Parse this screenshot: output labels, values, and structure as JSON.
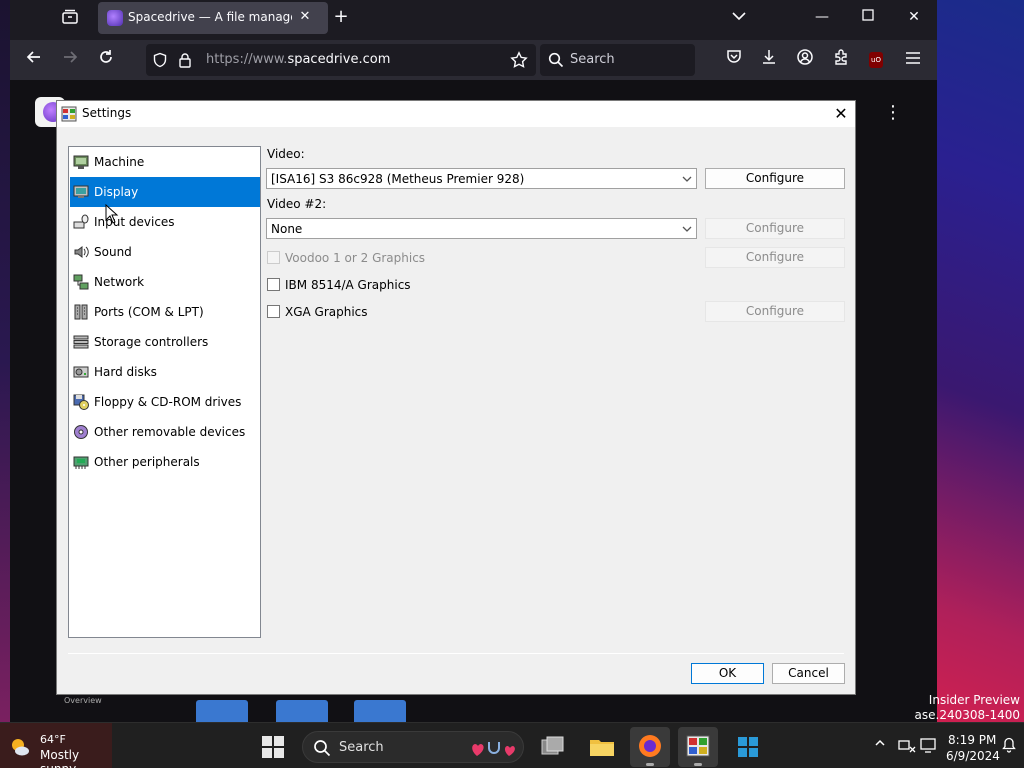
{
  "browser": {
    "tab_title": "Spacedrive — A file manager fr",
    "url_protocol": "https://www.",
    "url_host": "spacedrive.com",
    "search_placeholder": "Search",
    "ublock_label": "uO"
  },
  "background": {
    "overview_label": "Overview"
  },
  "dialog": {
    "title": "Settings",
    "categories": [
      {
        "label": "Machine",
        "icon": "machine-icon"
      },
      {
        "label": "Display",
        "icon": "display-icon",
        "selected": true
      },
      {
        "label": "Input devices",
        "icon": "input-devices-icon"
      },
      {
        "label": "Sound",
        "icon": "sound-icon"
      },
      {
        "label": "Network",
        "icon": "network-icon"
      },
      {
        "label": "Ports (COM & LPT)",
        "icon": "ports-icon"
      },
      {
        "label": "Storage controllers",
        "icon": "storage-controllers-icon"
      },
      {
        "label": "Hard disks",
        "icon": "hard-disk-icon"
      },
      {
        "label": "Floppy & CD-ROM drives",
        "icon": "floppy-cdrom-icon"
      },
      {
        "label": "Other removable devices",
        "icon": "removable-devices-icon"
      },
      {
        "label": "Other peripherals",
        "icon": "peripherals-icon"
      }
    ],
    "video_label": "Video:",
    "video_value": "[ISA16] S3 86c928 (Metheus Premier 928)",
    "video2_label": "Video #2:",
    "video2_value": "None",
    "voodoo_label": "Voodoo 1 or 2 Graphics",
    "ibm_label": "IBM 8514/A Graphics",
    "xga_label": "XGA Graphics",
    "configure_label": "Configure",
    "ok_label": "OK",
    "cancel_label": "Cancel"
  },
  "desktop": {
    "watermark_line1": "Insider Preview",
    "watermark_line2": "ase.240308-1400"
  },
  "taskbar": {
    "weather_temp": "64°F",
    "weather_desc": "Mostly sunny",
    "search_label": "Search",
    "clock_time": "8:19 PM",
    "clock_date": "6/9/2024"
  },
  "colors": {
    "selection": "#0078d7",
    "browser_chrome": "#1c1b22"
  }
}
